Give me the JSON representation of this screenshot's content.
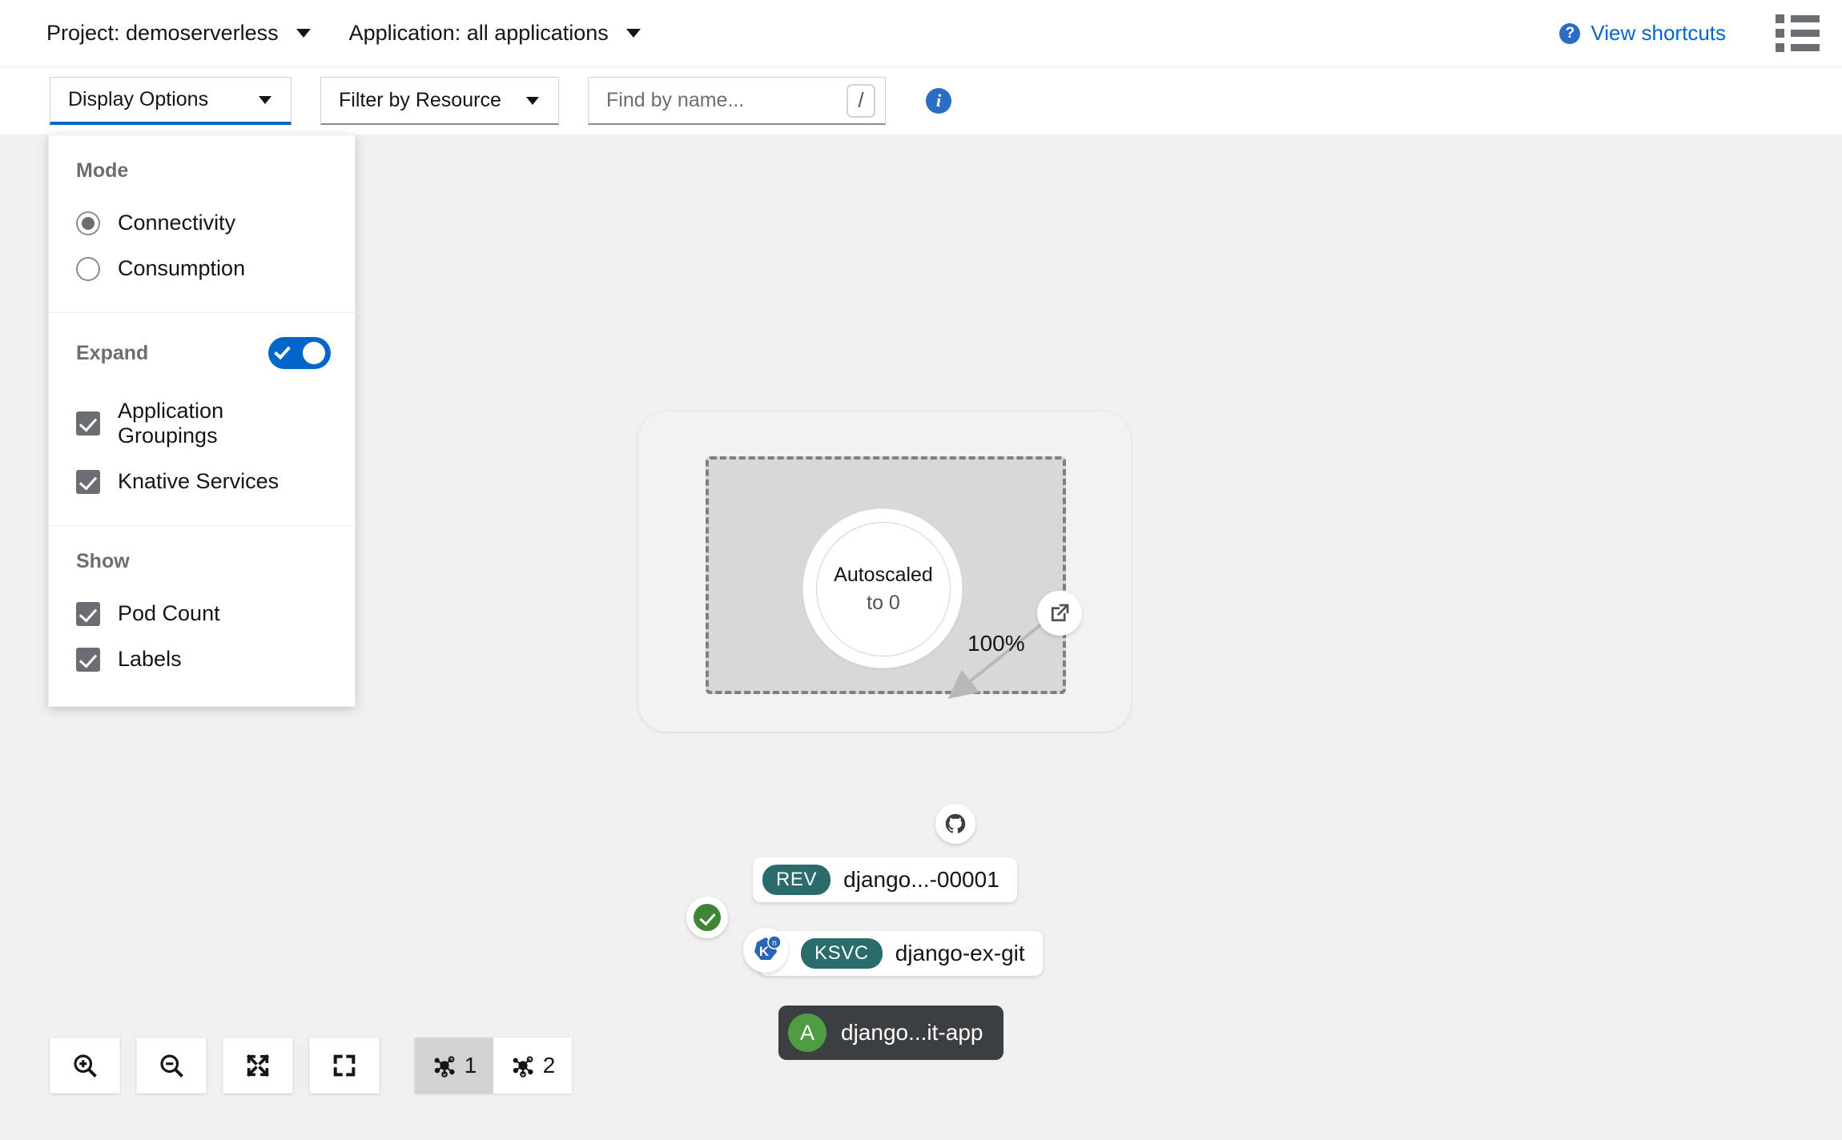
{
  "topbar": {
    "project_selector": {
      "label": "Project: demoserverless",
      "icon": "chevron-down-icon"
    },
    "application_selector": {
      "label": "Application: all applications",
      "icon": "chevron-down-icon"
    },
    "shortcuts_link": {
      "label": "View shortcuts",
      "icon": "help-circle-icon",
      "color": "#0066cc"
    },
    "list_view_icon": "list-view-icon"
  },
  "toolbar": {
    "display_options": {
      "label": "Display Options",
      "active": true,
      "accent": "#0066cc"
    },
    "filter_by_resource": {
      "label": "Filter by Resource"
    },
    "search": {
      "placeholder": "Find by name...",
      "value": "",
      "shortcut_key": "/"
    },
    "info_icon": "info-circle-icon"
  },
  "display_options_menu": {
    "sections": [
      {
        "title": "Mode",
        "type": "radio",
        "items": [
          {
            "label": "Connectivity",
            "checked": true
          },
          {
            "label": "Consumption",
            "checked": false
          }
        ]
      },
      {
        "title": "Expand",
        "type": "checkbox",
        "toggle": {
          "on": true,
          "color": "#0066cc"
        },
        "items": [
          {
            "label": "Application Groupings",
            "checked": true
          },
          {
            "label": "Knative Services",
            "checked": true
          }
        ]
      },
      {
        "title": "Show",
        "type": "checkbox",
        "items": [
          {
            "label": "Pod Count",
            "checked": true
          },
          {
            "label": "Labels",
            "checked": true
          }
        ]
      }
    ]
  },
  "topology": {
    "autoscaled": {
      "line1": "Autoscaled",
      "line2": "to 0"
    },
    "traffic_percent": "100%",
    "revision": {
      "badge": "REV",
      "name": "django...-00001",
      "badge_color": "#2a6b6b"
    },
    "knative_service": {
      "badge": "KSVC",
      "name": "django-ex-git",
      "badge_color": "#2a6b6b",
      "icon": "knative-icon"
    },
    "application_group": {
      "avatar": "A",
      "name": "django...it-app",
      "avatar_color": "#4f9c42",
      "pill_color": "#3c3f42"
    },
    "decorators": {
      "external_link": "external-link-icon",
      "source_repo": "github-icon",
      "status": {
        "icon": "check-circle-icon",
        "color": "#3e8635"
      }
    }
  },
  "bottom_toolbar": {
    "buttons": [
      {
        "name": "zoom-in",
        "icon": "zoom-in-icon"
      },
      {
        "name": "zoom-out",
        "icon": "zoom-out-icon"
      },
      {
        "name": "fit-to-screen",
        "icon": "expand-arrows-icon"
      },
      {
        "name": "reset-view",
        "icon": "crop-frame-icon"
      }
    ],
    "group_buttons": [
      {
        "label": "1",
        "icon": "topology-icon",
        "selected": true
      },
      {
        "label": "2",
        "icon": "topology-icon",
        "selected": false
      }
    ]
  }
}
